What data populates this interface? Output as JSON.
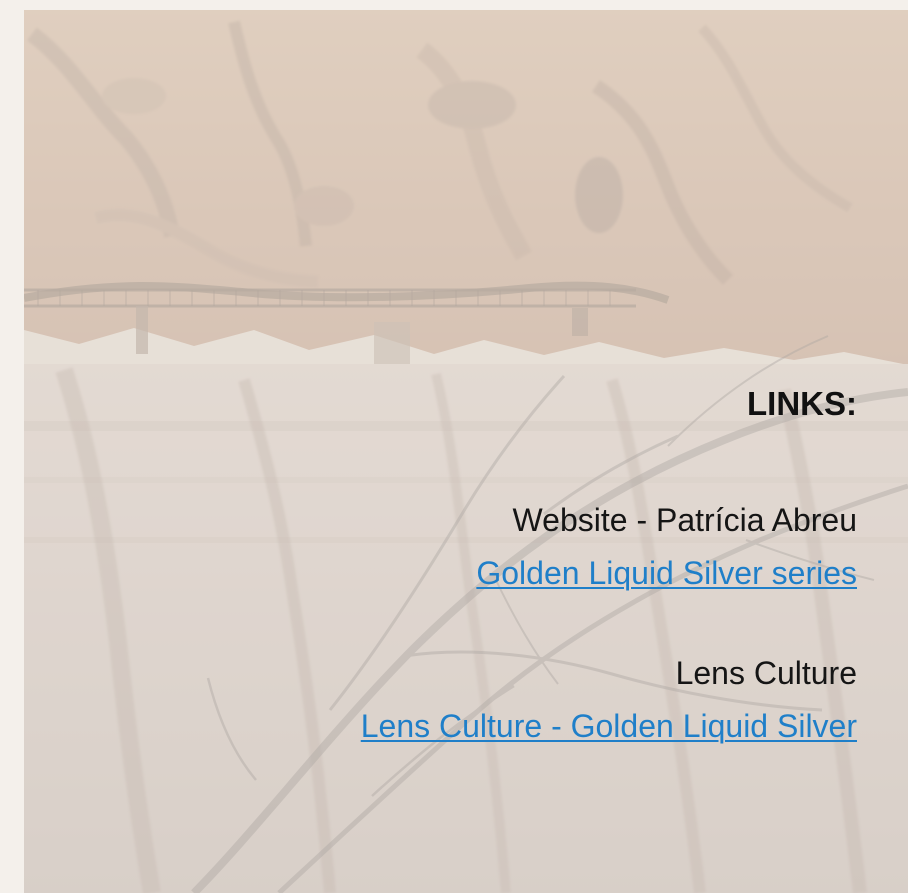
{
  "colors": {
    "link": "#1f7fc9",
    "text": "#111111",
    "background_wash": "#f6f1ec"
  },
  "background": {
    "icon": "landscape-photo-icon"
  },
  "links": {
    "heading": "LINKS:",
    "groups": [
      {
        "label": "Website - Patrícia Abreu",
        "link_text": "Golden Liquid Silver series"
      },
      {
        "label": "Lens Culture",
        "link_text": "Lens Culture - Golden Liquid Silver"
      }
    ]
  }
}
